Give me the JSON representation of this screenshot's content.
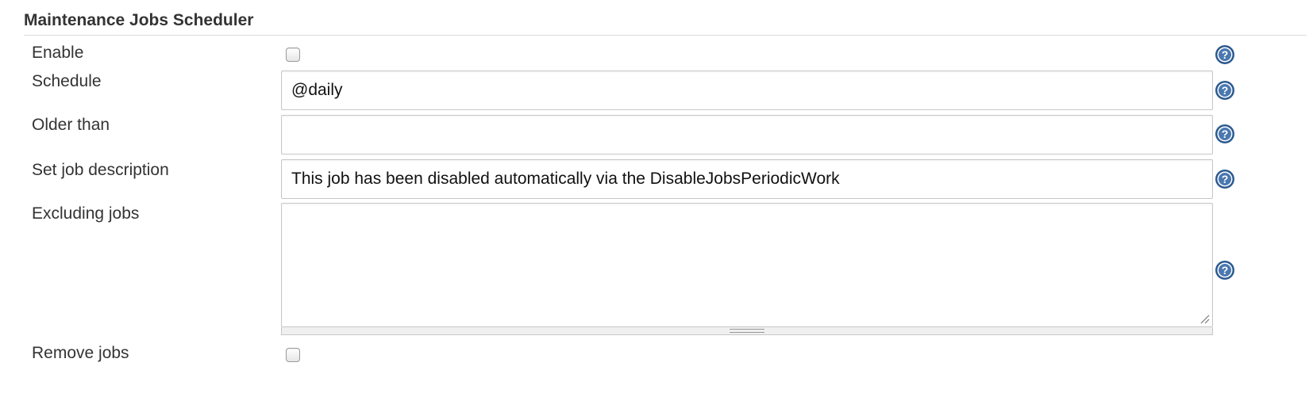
{
  "section": {
    "title": "Maintenance Jobs Scheduler"
  },
  "fields": {
    "enable": {
      "label": "Enable",
      "checked": false
    },
    "schedule": {
      "label": "Schedule",
      "value": "@daily"
    },
    "older_than": {
      "label": "Older than",
      "value": ""
    },
    "set_job_description": {
      "label": "Set job description",
      "value": "This job has been disabled automatically via the DisableJobsPeriodicWork"
    },
    "excluding_jobs": {
      "label": "Excluding jobs",
      "value": ""
    },
    "remove_jobs": {
      "label": "Remove jobs",
      "checked": false
    }
  },
  "icons": {
    "help": "help-question-icon",
    "resize": "resize-grip-icon"
  },
  "colors": {
    "help_icon_fill": "#4a78b0",
    "help_icon_ring": "#2d5a8f",
    "border": "#c7c7c7",
    "text": "#333333"
  }
}
